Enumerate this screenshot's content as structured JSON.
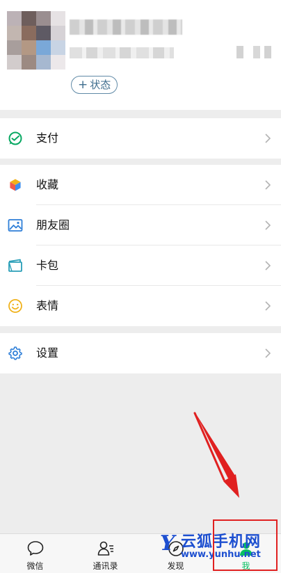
{
  "profile": {
    "status_button": "状态",
    "status_plus": "+"
  },
  "menu": {
    "pay": "支付",
    "favorites": "收藏",
    "moments": "朋友圈",
    "cards": "卡包",
    "stickers": "表情",
    "settings": "设置"
  },
  "tabs": [
    {
      "label": "微信",
      "icon": "chat-bubble-icon"
    },
    {
      "label": "通讯录",
      "icon": "contacts-icon"
    },
    {
      "label": "发现",
      "icon": "compass-icon"
    },
    {
      "label": "我",
      "icon": "person-icon",
      "active": true
    }
  ],
  "watermark": {
    "logo_letter": "Y",
    "title": "云狐手机网",
    "url": "www.yunhu.net"
  },
  "colors": {
    "accent_green": "#07c160",
    "highlight_red": "#e02020",
    "status_blue": "#3f6e8e"
  }
}
